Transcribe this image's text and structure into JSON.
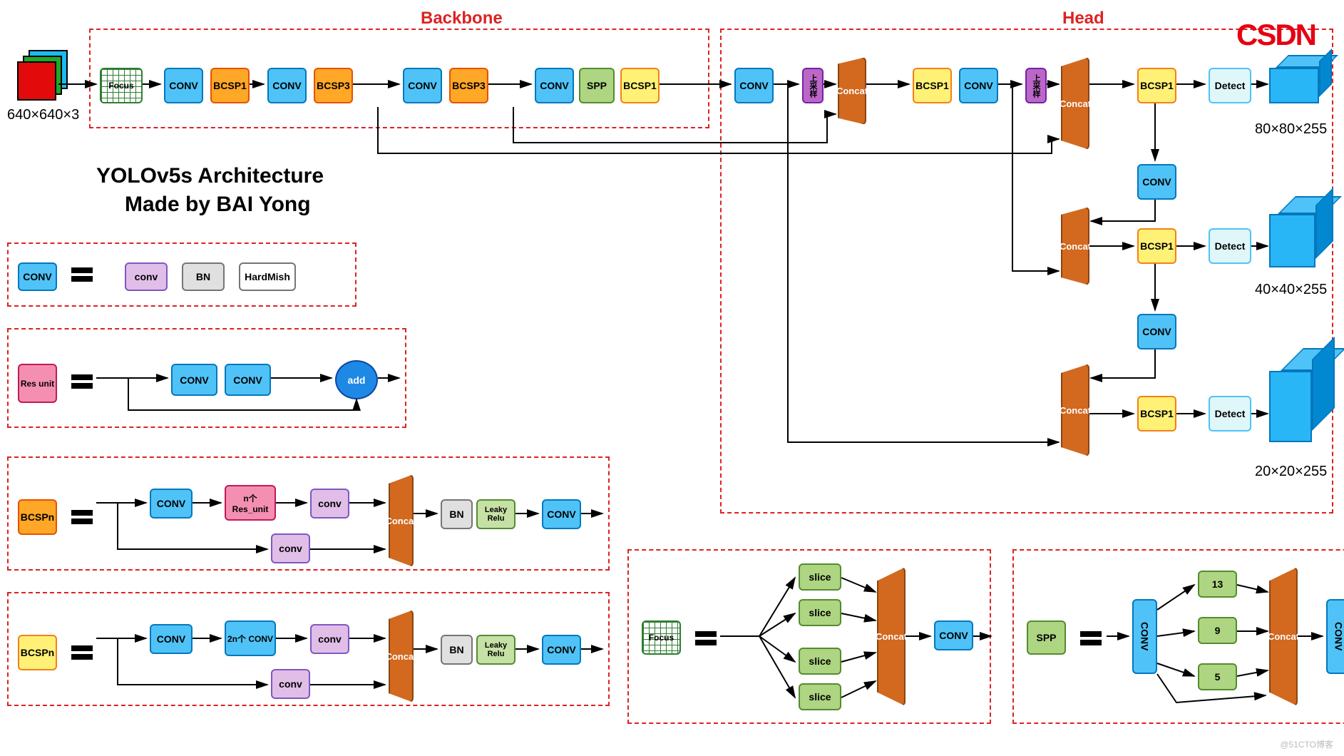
{
  "title": "YOLOv5s Architecture",
  "author": "Made by BAI Yong",
  "watermark": "CSDN",
  "corner_watermark": "@51CTO博客",
  "backbone": {
    "label": "Backbone",
    "input_dim": "640×640×3",
    "blocks": [
      "Focus",
      "CONV",
      "BCSP1",
      "CONV",
      "BCSP3",
      "CONV",
      "BCSP3",
      "CONV",
      "SPP",
      "BCSP1"
    ]
  },
  "head": {
    "label": "Head",
    "blocks": {
      "conv": "CONV",
      "upsample": "上采样",
      "concat": "Concat",
      "bcsp1": "BCSP1",
      "detect": "Detect"
    },
    "outputs": [
      "80×80×255",
      "40×40×255",
      "20×20×255"
    ]
  },
  "legends": {
    "conv": {
      "name": "CONV",
      "parts": [
        "conv",
        "BN",
        "HardMish"
      ]
    },
    "res": {
      "name": "Res unit",
      "parts": [
        "CONV",
        "CONV",
        "add"
      ]
    },
    "bcspn_o": {
      "name": "BCSPn",
      "parts": {
        "conv": "CONV",
        "nres": "n个 Res_unit",
        "convsm": "conv",
        "concat": "Concat",
        "bn": "BN",
        "leaky": "Leaky Relu",
        "out": "CONV"
      }
    },
    "bcspn_y": {
      "name": "BCSPn",
      "parts": {
        "conv": "CONV",
        "n2conv": "2n个 CONV",
        "convsm": "conv",
        "concat": "Concat",
        "bn": "BN",
        "leaky": "Leaky Relu",
        "out": "CONV"
      }
    },
    "focus": {
      "name": "Focus",
      "slice": "slice",
      "concat": "Concat",
      "conv": "CONV"
    },
    "spp": {
      "name": "SPP",
      "conv": "CONV",
      "pools": [
        "13",
        "9",
        "5"
      ],
      "concat": "Concat"
    }
  }
}
